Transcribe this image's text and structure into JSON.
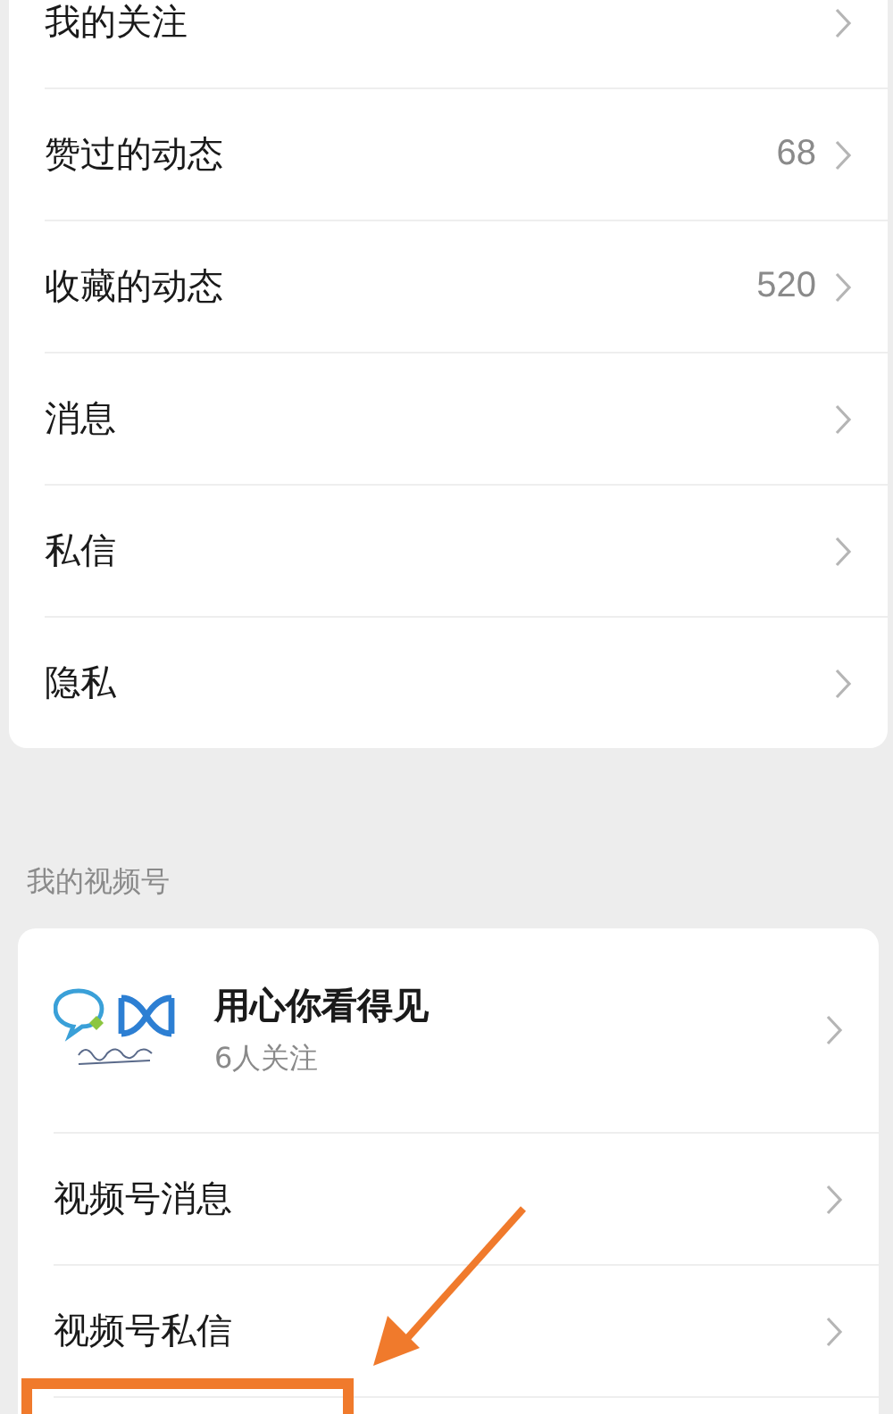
{
  "menu": {
    "items": [
      {
        "label": "我的关注"
      },
      {
        "label": "赞过的动态",
        "count": "68"
      },
      {
        "label": "收藏的动态",
        "count": "520"
      },
      {
        "label": "消息"
      },
      {
        "label": "私信"
      },
      {
        "label": "隐私"
      }
    ]
  },
  "channels_section": {
    "title": "我的视频号",
    "account": {
      "name": "用心你看得见",
      "followers": "6人关注"
    },
    "items": [
      {
        "label": "视频号消息"
      },
      {
        "label": "视频号私信"
      }
    ]
  }
}
